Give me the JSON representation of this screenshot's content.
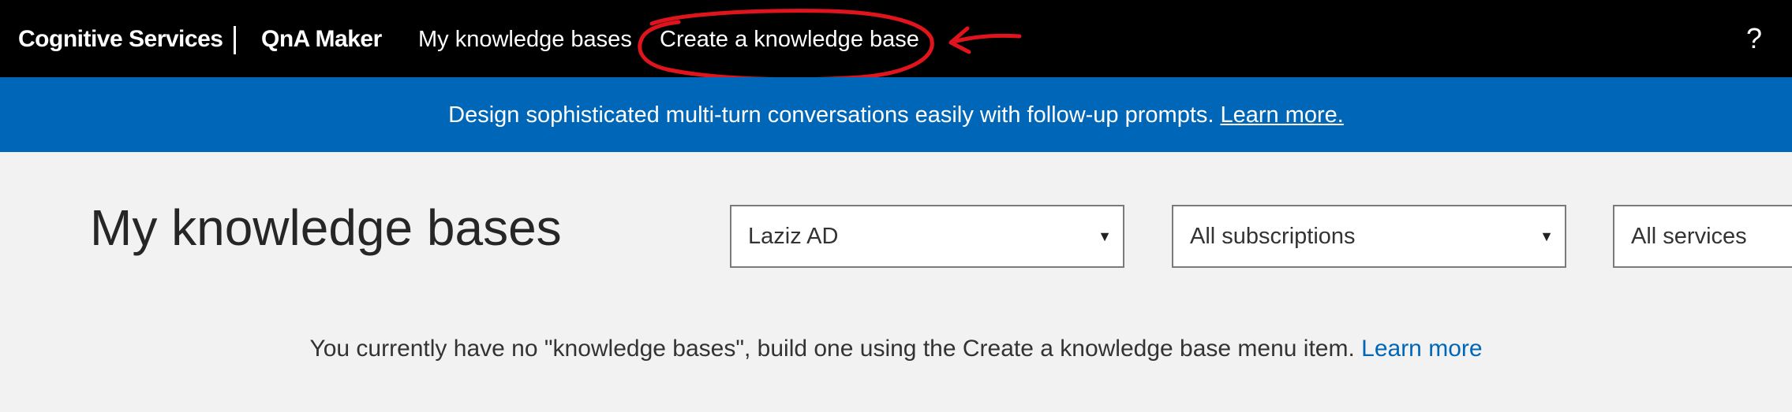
{
  "header": {
    "brand": "Cognitive Services",
    "product": "QnA Maker",
    "nav": {
      "my_kbs": "My knowledge bases",
      "create_kb": "Create a knowledge base"
    },
    "help": "?"
  },
  "banner": {
    "text": "Design sophisticated multi-turn conversations easily with follow-up prompts. ",
    "link": "Learn more."
  },
  "main": {
    "title": "My knowledge bases",
    "filters": {
      "directory": "Laziz AD",
      "subscription": "All subscriptions",
      "service": "All services"
    },
    "empty_message": "You currently have no \"knowledge bases\", build one using the Create a knowledge base menu item. ",
    "empty_link": "Learn more"
  },
  "colors": {
    "topbar": "#000000",
    "banner": "#0067b8",
    "annotation": "#e0141c",
    "link": "#0067b8"
  }
}
